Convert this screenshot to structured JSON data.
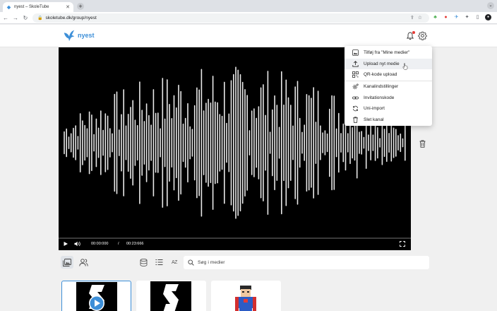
{
  "browser": {
    "tab_title": "nyest – SkoleTube",
    "url": "skoletube.dk/group/nyest"
  },
  "header": {
    "logo_text": "nyest",
    "brand_color": "#3d8fd8"
  },
  "player": {
    "current_time": "00:00:000",
    "separator": "/",
    "duration": "00:23:666",
    "progress": 0
  },
  "menu": {
    "items": [
      {
        "label": "Tilføj fra \"Mine medier\"",
        "icon": "image-add-icon"
      },
      {
        "label": "Upload nyt medie",
        "icon": "upload-icon"
      },
      {
        "label": "QR-kode upload",
        "icon": "qr-code-icon"
      },
      {
        "label": "Kanalindstillinger",
        "icon": "settings-cog-icon"
      },
      {
        "label": "Invitationskode",
        "icon": "link-icon"
      },
      {
        "label": "Uni-import",
        "icon": "sync-icon"
      },
      {
        "label": "Slet kanal",
        "icon": "trash-icon"
      }
    ]
  },
  "toolbar": {
    "search_placeholder": "Søg i medier",
    "sort_label": "AZ"
  },
  "media": [
    {
      "icon": "play-icon"
    },
    {
      "icon": "letter-s-icon"
    },
    {
      "icon": "superhero-icon"
    }
  ]
}
